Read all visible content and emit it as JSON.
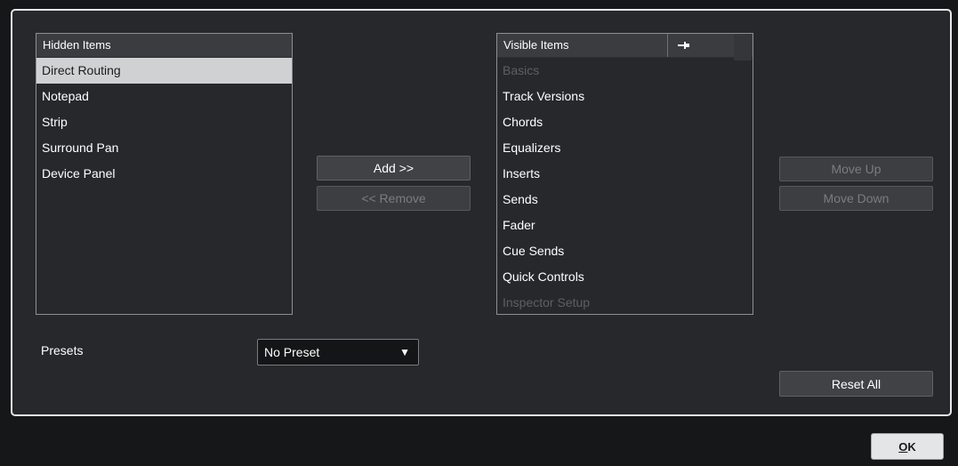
{
  "hidden_list": {
    "header": "Hidden Items",
    "items": [
      {
        "label": "Direct Routing",
        "selected": true
      },
      {
        "label": "Notepad"
      },
      {
        "label": "Strip"
      },
      {
        "label": "Surround Pan"
      },
      {
        "label": "Device Panel"
      }
    ]
  },
  "visible_list": {
    "header": "Visible Items",
    "pin_icon": "pin-icon",
    "items": [
      {
        "label": "Basics",
        "disabled": true
      },
      {
        "label": "Track Versions"
      },
      {
        "label": "Chords"
      },
      {
        "label": "Equalizers"
      },
      {
        "label": "Inserts"
      },
      {
        "label": "Sends"
      },
      {
        "label": "Fader"
      },
      {
        "label": "Cue Sends"
      },
      {
        "label": "Quick Controls"
      },
      {
        "label": "Inspector Setup",
        "disabled": true
      }
    ]
  },
  "buttons": {
    "add": "Add >>",
    "remove": "<< Remove",
    "move_up": "Move Up",
    "move_down": "Move Down",
    "reset_all": "Reset All"
  },
  "presets": {
    "label": "Presets",
    "value": "No Preset"
  },
  "footer": {
    "ok_mnemonic": "O",
    "ok_rest": "K"
  },
  "colors": {
    "panel_bg": "#26282c",
    "selected_bg": "#cfd1d3",
    "disabled_text": "#5d5f63"
  }
}
